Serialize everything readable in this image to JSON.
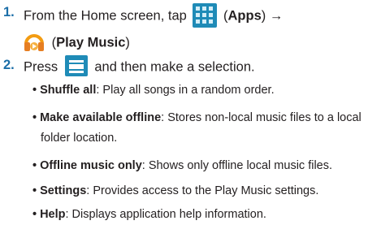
{
  "steps": [
    {
      "number": "1.",
      "text_a": "From the Home screen, tap",
      "apps_label": "Apps",
      "arrow": "→",
      "play_music_label": "Play Music",
      "icons": [
        "apps-grid-icon",
        "play-music-headphones-icon"
      ]
    },
    {
      "number": "2.",
      "text_a": "Press",
      "text_b": "and then make a selection.",
      "icons": [
        "menu-key-icon"
      ]
    }
  ],
  "options": [
    {
      "term": "Shuffle all",
      "desc": ": Play all songs in a random order."
    },
    {
      "term": "Make available offline",
      "desc": ": Stores non-local music files to a local",
      "desc_cont": "folder location."
    },
    {
      "term": "Offline music only",
      "desc": ": Shows only offline local music files."
    },
    {
      "term": "Settings",
      "desc": ": Provides access to the Play Music settings."
    },
    {
      "term": "Help",
      "desc": ": Displays application help information."
    }
  ],
  "colors": {
    "step_number": "#1b6ea8",
    "icon_blue": "#1f8bb7",
    "headphone_orange": "#f39c12"
  }
}
